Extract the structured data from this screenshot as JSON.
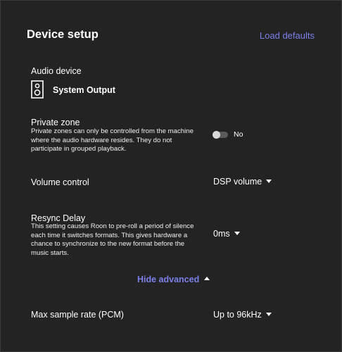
{
  "header": {
    "title": "Device setup",
    "load_defaults": "Load defaults"
  },
  "audio_device": {
    "label": "Audio device",
    "icon": "speaker-icon",
    "name": "System Output"
  },
  "private_zone": {
    "label": "Private zone",
    "description": "Private zones can only be controlled from the machine where the audio hardware resides. They do not participate in grouped playback.",
    "value": "No"
  },
  "volume_control": {
    "label": "Volume control",
    "value": "DSP volume"
  },
  "resync_delay": {
    "label": "Resync Delay",
    "description": "This setting causes Roon to pre-roll a period of silence each time it switches formats. This gives hardware a chance to synchronize to the new format before the music starts.",
    "value": "0ms"
  },
  "advanced": {
    "toggle_label": "Hide advanced"
  },
  "max_sample_rate": {
    "label": "Max sample rate (PCM)",
    "value": "Up to 96kHz"
  },
  "colors": {
    "background": "#232323",
    "accent": "#7b7fe8",
    "text": "#ffffff"
  }
}
